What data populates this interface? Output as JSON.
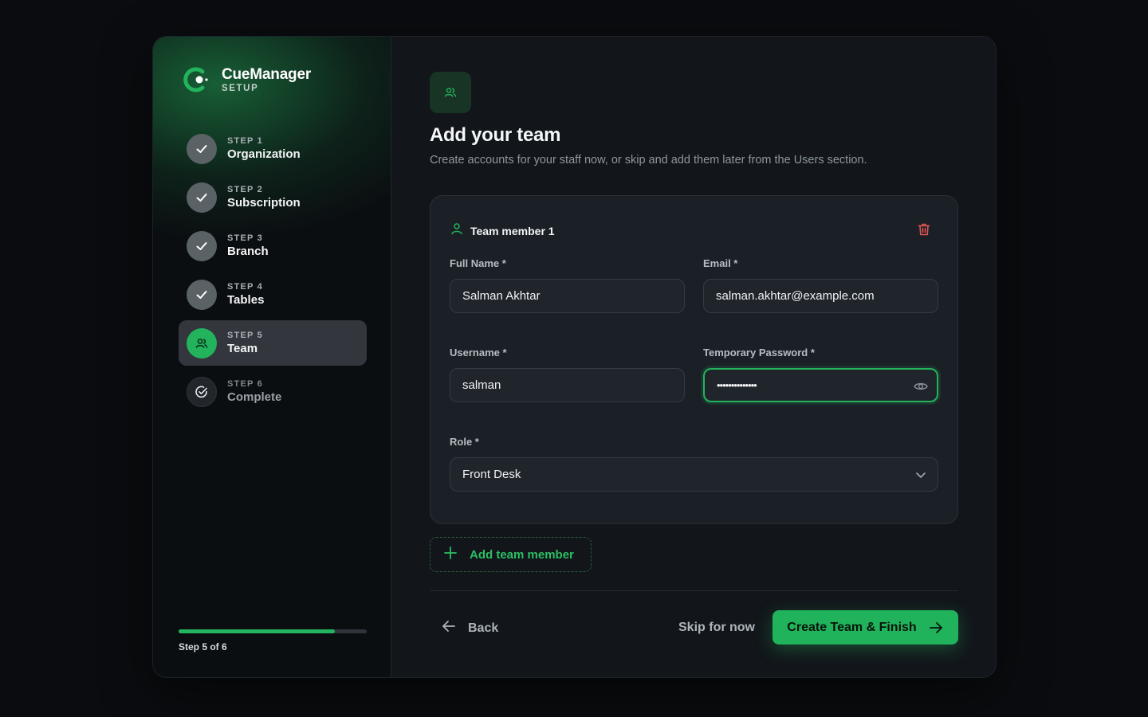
{
  "brand": {
    "name": "CueManager",
    "sub": "SETUP"
  },
  "steps": [
    {
      "num": "STEP 1",
      "label": "Organization",
      "state": "done",
      "icon": "check-icon"
    },
    {
      "num": "STEP 2",
      "label": "Subscription",
      "state": "done",
      "icon": "check-icon"
    },
    {
      "num": "STEP 3",
      "label": "Branch",
      "state": "done",
      "icon": "check-icon"
    },
    {
      "num": "STEP 4",
      "label": "Tables",
      "state": "done",
      "icon": "check-icon"
    },
    {
      "num": "STEP 5",
      "label": "Team",
      "state": "active",
      "icon": "users-icon"
    },
    {
      "num": "STEP 6",
      "label": "Complete",
      "state": "pending",
      "icon": "check-circle-icon"
    }
  ],
  "progress": {
    "fraction": 0.83,
    "text": "Step 5 of 6"
  },
  "page": {
    "title": "Add your team",
    "subtitle": "Create accounts for your staff now, or skip and add them later from the Users section."
  },
  "member": {
    "title": "Team member 1",
    "full_name_label": "Full Name *",
    "full_name": "Salman Akhtar",
    "email_label": "Email *",
    "email": "salman.akhtar@example.com",
    "username_label": "Username *",
    "username": "salman",
    "password_label": "Temporary Password *",
    "password": "••••••••••••••",
    "role_label": "Role *",
    "role": "Front Desk"
  },
  "actions": {
    "add_member": "Add team member",
    "back": "Back",
    "skip": "Skip for now",
    "finish": "Create Team & Finish"
  },
  "colors": {
    "accent": "#22b35c",
    "background": "#0a0c0f",
    "card": "#12161b",
    "danger": "#e05555"
  }
}
